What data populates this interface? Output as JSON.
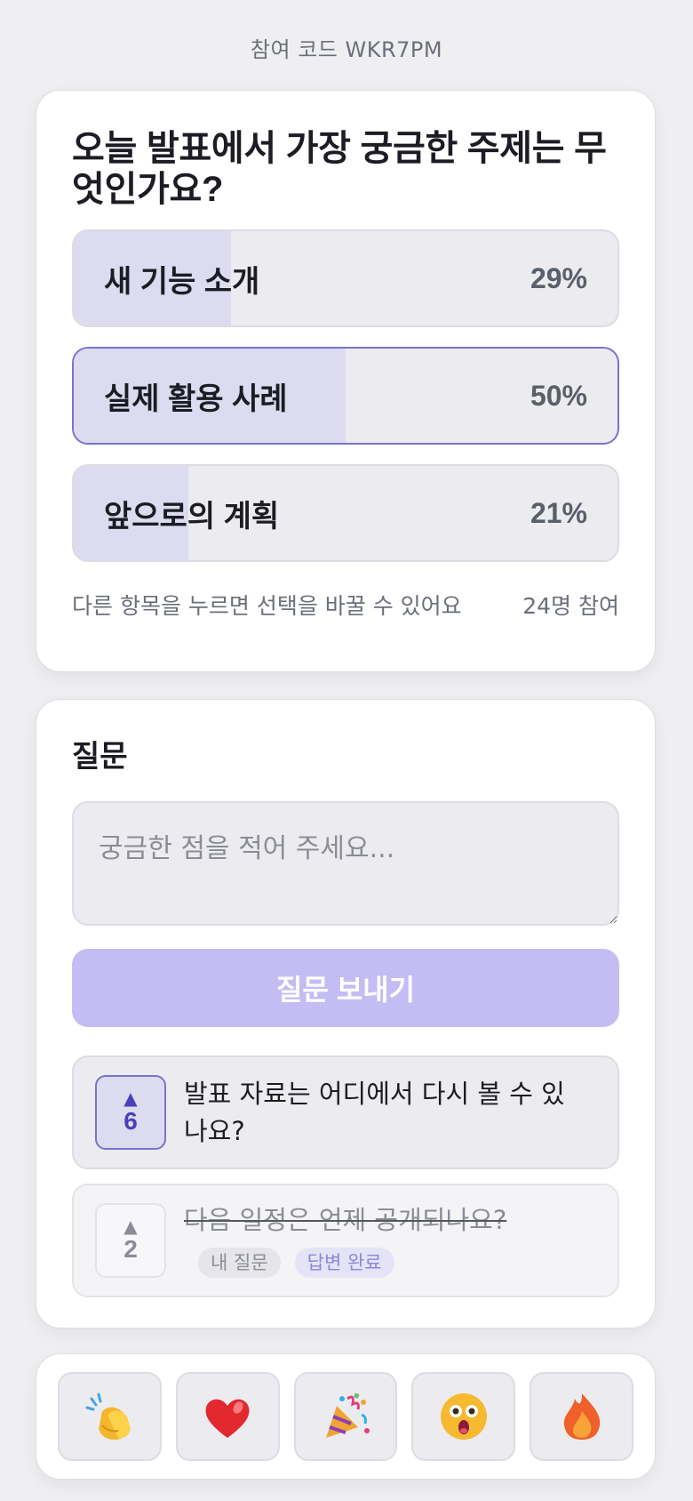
{
  "header": {
    "join_code": "참여 코드 WKR7PM"
  },
  "poll": {
    "question": "오늘 발표에서 가장 궁금한 주제는 무엇인가요?",
    "options": [
      {
        "label": "새 기능 소개",
        "percent_text": "29%",
        "percent": 29,
        "selected": false
      },
      {
        "label": "실제 활용 사례",
        "percent_text": "50%",
        "percent": 50,
        "selected": true
      },
      {
        "label": "앞으로의 계획",
        "percent_text": "21%",
        "percent": 21,
        "selected": false
      }
    ],
    "hint": "다른 항목을 누르면 선택을 바꿀 수 있어요",
    "participants": "24명 참여"
  },
  "qa": {
    "title": "질문",
    "input_placeholder": "궁금한 점을 적어 주세요...",
    "input_value": "",
    "send_label": "질문 보내기",
    "questions": [
      {
        "votes": "6",
        "text": "발표 자료는 어디에서 다시 볼 수 있나요?",
        "answered": false
      },
      {
        "votes": "2",
        "text": "다음 일정은 언제 공개되나요?",
        "answered": true,
        "tag_mine": "내 질문",
        "tag_answered": "답변 완료"
      }
    ],
    "vote_arrow": "▲"
  },
  "reactions": [
    {
      "icon": "clapping-hands-icon"
    },
    {
      "icon": "heart-icon"
    },
    {
      "icon": "party-popper-icon"
    },
    {
      "icon": "surprised-face-icon"
    },
    {
      "icon": "fire-icon"
    }
  ],
  "colors": {
    "accent": "#7b72cc",
    "accent_fill": "#dcdbef",
    "send_button": "#c4bdf3",
    "background": "#efeff2"
  }
}
